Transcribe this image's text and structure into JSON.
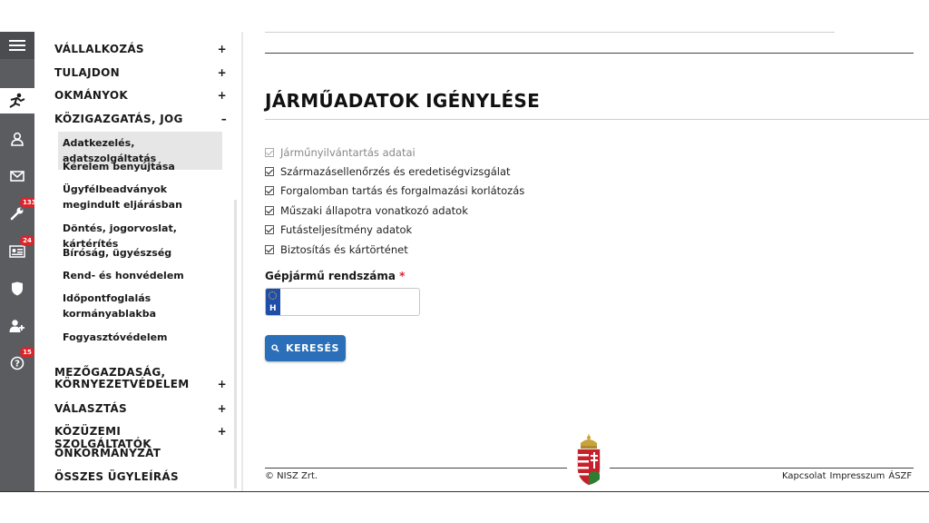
{
  "colors": {
    "rail_bg": "#5a5c60",
    "badge": "#d7262c",
    "primary_button": "#2a6fb8",
    "required_asterisk": "#d7262c"
  },
  "rail": {
    "items": [
      {
        "icon": "hamburger-menu-icon"
      },
      {
        "icon": "vehicle-person-icon",
        "active": true
      },
      {
        "icon": "user-icon"
      },
      {
        "icon": "envelope-icon"
      },
      {
        "icon": "wrench-icon",
        "badge": "133"
      },
      {
        "icon": "id-card-icon",
        "badge": "24"
      },
      {
        "icon": "shield-icon"
      },
      {
        "icon": "add-user-icon"
      },
      {
        "icon": "help-icon",
        "badge": "15"
      }
    ]
  },
  "sidebar": {
    "categories_top": [
      {
        "label": "VÁLLALKOZÁS",
        "toggle": "+"
      },
      {
        "label": "TULAJDON",
        "toggle": "+"
      },
      {
        "label": "OKMÁNYOK",
        "toggle": "+"
      },
      {
        "label": "KÖZIGAZGATÁS, JOG",
        "toggle": "–"
      }
    ],
    "subitems": [
      {
        "label": "Adatkezelés, adatszolgáltatás",
        "active": true
      },
      {
        "label": "Kérelem benyújtása"
      },
      {
        "label": "Ügyfélbeadványok megindult eljárásban"
      },
      {
        "label": "Döntés, jogorvoslat, kártérítés"
      },
      {
        "label": "Bíróság, ügyészség"
      },
      {
        "label": "Rend- és honvédelem"
      },
      {
        "label": "Időpontfoglalás kormányablakba"
      },
      {
        "label": "Fogyasztóvédelem"
      }
    ],
    "categories_bottom": [
      {
        "label": "MEZŐGAZDASÁG, KÖRNYEZETVÉDELEM",
        "toggle": "+"
      },
      {
        "label": "VÁLASZTÁS",
        "toggle": "+"
      },
      {
        "label": "KÖZÜZEMI SZOLGÁLTATÓK",
        "toggle": "+"
      },
      {
        "label": "ÖNKORMÁNYZAT",
        "toggle": ""
      },
      {
        "label": "ÖSSZES ÜGYLEÍRÁS",
        "toggle": ""
      }
    ]
  },
  "main": {
    "title": "JÁRMŰADATOK IGÉNYLÉSE",
    "checkboxes": [
      {
        "label": "Járműnyilvántartás adatai",
        "checked": true,
        "disabled": true
      },
      {
        "label": "Származásellenőrzés és eredetiségvizsgálat",
        "checked": true,
        "disabled": false
      },
      {
        "label": "Forgalomban tartás és forgalmazási korlátozás",
        "checked": true,
        "disabled": false
      },
      {
        "label": "Műszaki állapotra vonatkozó adatok",
        "checked": true,
        "disabled": false
      },
      {
        "label": "Futásteljesítmény adatok",
        "checked": true,
        "disabled": false
      },
      {
        "label": "Biztosítás és kártörténet",
        "checked": true,
        "disabled": false
      }
    ],
    "plate_field": {
      "label": "Gépjármű rendszáma",
      "required_mark": "*",
      "country_code": "H",
      "value": ""
    },
    "search_button": "KERESÉS"
  },
  "footer": {
    "copyright": "© NISZ Zrt.",
    "links": [
      "Kapcsolat",
      "Impresszum",
      "ÁSZF"
    ]
  }
}
